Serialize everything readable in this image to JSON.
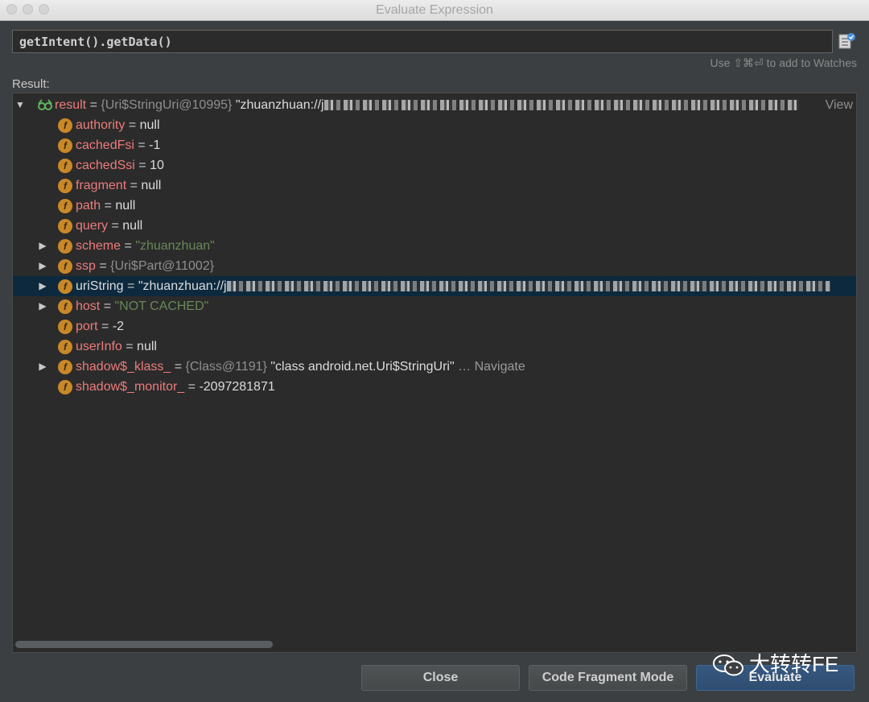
{
  "window": {
    "title": "Evaluate Expression"
  },
  "expression": {
    "value": "getIntent().getData()"
  },
  "hint": "Use ⇧⌘⏎ to add to Watches",
  "result_label": "Result:",
  "tree": {
    "root": {
      "name": "result",
      "eq": " = ",
      "type": "{Uri$StringUri@10995}",
      "value": "\"zhuanzhuan://j",
      "view": "View"
    },
    "rows": [
      {
        "name": "authority",
        "eq": " = ",
        "value": "null"
      },
      {
        "name": "cachedFsi",
        "eq": " = ",
        "value": "-1"
      },
      {
        "name": "cachedSsi",
        "eq": " = ",
        "value": "10"
      },
      {
        "name": "fragment",
        "eq": " = ",
        "value": "null"
      },
      {
        "name": "path",
        "eq": " = ",
        "value": "null"
      },
      {
        "name": "query",
        "eq": " = ",
        "value": "null"
      },
      {
        "name": "scheme",
        "eq": " = ",
        "value": "\"zhuanzhuan\""
      },
      {
        "name": "ssp",
        "eq": " = ",
        "value": "{Uri$Part@11002}"
      },
      {
        "name": "uriString",
        "eq": " = ",
        "value": "\"zhuanzhuan://j"
      },
      {
        "name": "host",
        "eq": " = ",
        "value": "\"NOT CACHED\""
      },
      {
        "name": "port",
        "eq": " = ",
        "value": "-2"
      },
      {
        "name": "userInfo",
        "eq": " = ",
        "value": "null"
      },
      {
        "name": "shadow$_klass_",
        "eq": " = ",
        "type": "{Class@1191}",
        "value": "\"class android.net.Uri$StringUri\"",
        "extra": " … Navigate"
      },
      {
        "name": "shadow$_monitor_",
        "eq": " = ",
        "value": "-2097281871"
      }
    ],
    "field_icon_letter": "f"
  },
  "buttons": {
    "close": "Close",
    "code_fragment": "Code Fragment Mode",
    "evaluate": "Evaluate"
  },
  "watermark": "大转转FE",
  "colors": {
    "background": "#3c3f41",
    "field_name": "#ed7b7b",
    "string_value": "#6a8759",
    "field_icon": "#c98828",
    "selection": "#0d293e",
    "primary_button": "#365880"
  },
  "icons": [
    "tree-expanded-icon",
    "tree-collapsed-icon",
    "field-icon",
    "watch-result-icon",
    "add-to-watches-icon",
    "wechat-icon"
  ]
}
